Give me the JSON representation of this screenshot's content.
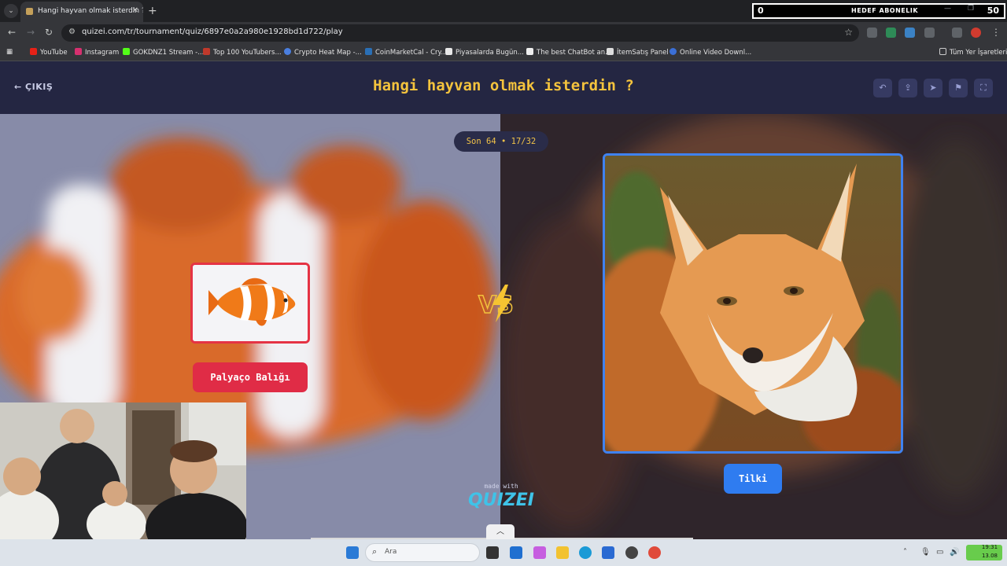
{
  "browser": {
    "tab_title": "Hangi hayvan olmak isterdin ? ...",
    "tab_close": "✕",
    "new_tab": "+",
    "url": "quizei.com/tr/tournament/quiz/6897e0a2a980e1928bd1d722/play",
    "bookmarks": [
      "YouTube",
      "Instagram",
      "GOKDNZ1 Stream -...",
      "Top 100 YouTubers...",
      "Crypto Heat Map -...",
      "CoinMarketCal - Cry...",
      "Piyasalarda Bugün...",
      "The best ChatBot an...",
      "İtemSatış Panel",
      "Online Video Downl...",
      "Tüm Yer İşaretleri"
    ]
  },
  "overlay_goal": {
    "current": "0",
    "label": "HEDEF ABONELIK",
    "target": "50"
  },
  "app": {
    "exit_label": "ÇIKIŞ",
    "title": "Hangi hayvan olmak isterdin ?",
    "round_label": "Son 64 • 17/32",
    "left_choice": "Palyaço Balığı",
    "right_choice": "Tilki",
    "vs": "VS",
    "made_with": "made with",
    "logo": "QUIZEI"
  },
  "taskbar": {
    "search_placeholder": "Ara",
    "time": "19:31",
    "date": "13.08"
  },
  "colors": {
    "title": "#f4c33d",
    "left_accent": "#e02c46",
    "right_accent": "#2f7cf0"
  }
}
